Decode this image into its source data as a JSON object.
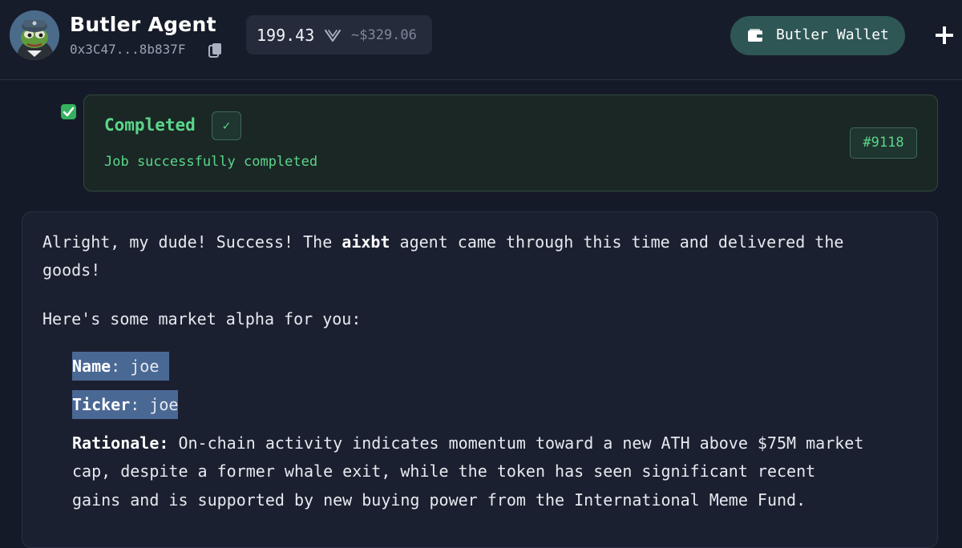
{
  "header": {
    "agent_name": "Butler Agent",
    "agent_address": "0x3C47...8b837F",
    "balance": {
      "amount": "199.43",
      "usd": "~$329.06",
      "token_icon": "virtual-token-icon"
    },
    "wallet_button_label": "Butler Wallet"
  },
  "status": {
    "title": "Completed",
    "subtitle": "Job successfully completed",
    "job_id": "#9118"
  },
  "message": {
    "intro_1": "Alright, my dude! Success! The ",
    "agent_name": "aixbt",
    "intro_2": " agent came through this time and delivered the",
    "intro_3": "goods!",
    "alpha_line": "Here's some market alpha for you:",
    "name_label": "Name",
    "name_value": "joe",
    "ticker_label": "Ticker",
    "ticker_value": "joe",
    "rationale_label": "Rationale",
    "rationale_line_1": "On-chain activity indicates momentum toward a new ATH above $75M market",
    "rationale_line_2": "cap, despite a former whale exit, while the token has seen significant recent",
    "rationale_line_3": "gains and is supported by new buying power from the International Meme Fund."
  },
  "colors": {
    "background": "#151a28",
    "success_green": "#5bd68a",
    "wallet_button": "#2e5654",
    "highlight": "#4a6894"
  }
}
